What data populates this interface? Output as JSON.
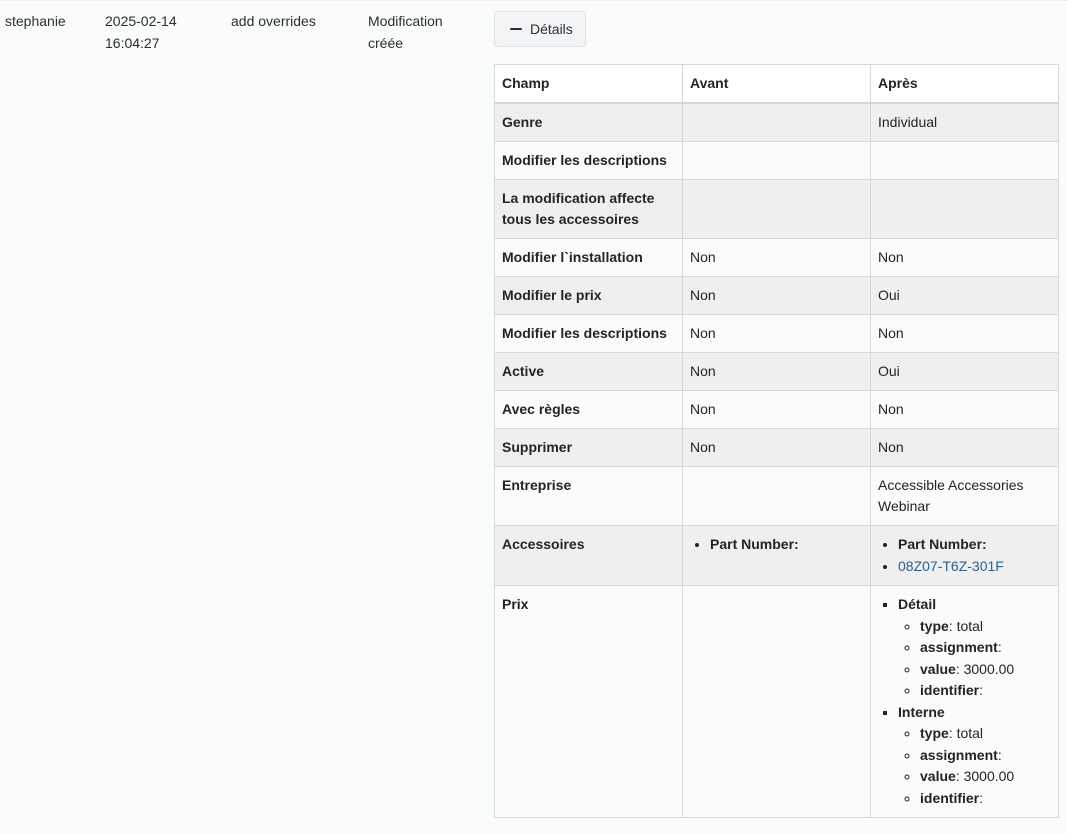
{
  "row": {
    "user": "stephanie",
    "date": "2025-02-14",
    "time": "16:04:27",
    "action": "add overrides",
    "type_line1": "Modification",
    "type_line2": "créée"
  },
  "details_button": {
    "label": "Détails",
    "icon": "minus-icon"
  },
  "table": {
    "headers": [
      "Champ",
      "Avant",
      "Après"
    ],
    "rows": [
      {
        "field": "Genre",
        "before": "",
        "after": "Individual"
      },
      {
        "field": "Modifier les descriptions",
        "before": "",
        "after": ""
      },
      {
        "field": "La modification affecte tous les accessoires",
        "before": "",
        "after": ""
      },
      {
        "field": "Modifier l`installation",
        "before": "Non",
        "after": "Non"
      },
      {
        "field": "Modifier le prix",
        "before": "Non",
        "after": "Oui"
      },
      {
        "field": "Modifier les descriptions",
        "before": "Non",
        "after": "Non"
      },
      {
        "field": "Active",
        "before": "Non",
        "after": "Oui"
      },
      {
        "field": "Avec règles",
        "before": "Non",
        "after": "Non"
      },
      {
        "field": "Supprimer",
        "before": "Non",
        "after": "Non"
      },
      {
        "field": "Entreprise",
        "before": "",
        "after": "Accessible Accessories Webinar"
      }
    ],
    "accessoires": {
      "field": "Accessoires",
      "before_item": "Part Number:",
      "after_item1": "Part Number:",
      "after_link": "08Z07-T6Z-301F"
    },
    "prix": {
      "field": "Prix",
      "groups": [
        {
          "name": "Détail",
          "items": [
            {
              "key": "type",
              "sep": ":",
              "value": " total"
            },
            {
              "key": "assignment",
              "sep": ":",
              "value": ""
            },
            {
              "key": "value",
              "sep": ":",
              "value": " 3000.00"
            },
            {
              "key": "identifier",
              "sep": ":",
              "value": ""
            }
          ]
        },
        {
          "name": "Interne",
          "items": [
            {
              "key": "type",
              "sep": ":",
              "value": " total"
            },
            {
              "key": "assignment",
              "sep": ":",
              "value": ""
            },
            {
              "key": "value",
              "sep": ":",
              "value": " 3000.00"
            },
            {
              "key": "identifier",
              "sep": ":",
              "value": ""
            }
          ]
        }
      ]
    }
  }
}
